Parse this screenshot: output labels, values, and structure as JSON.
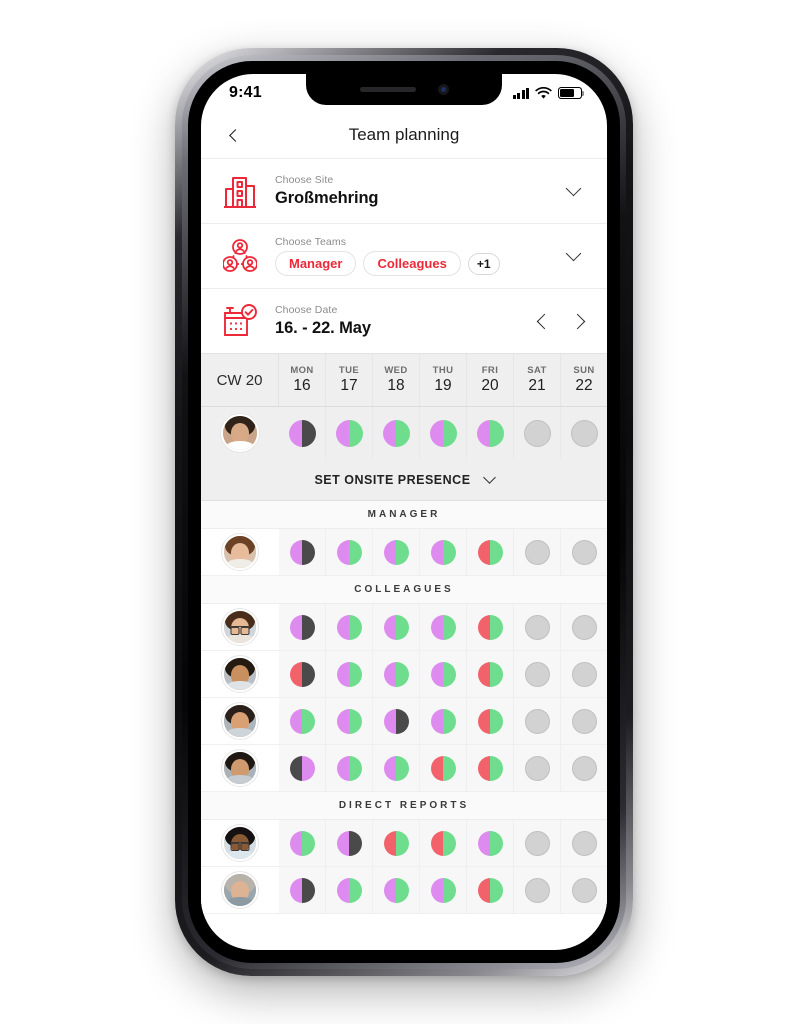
{
  "status_bar": {
    "time": "9:41",
    "signal_icon": "cellular-bars-icon",
    "wifi_icon": "wifi-icon",
    "battery_icon": "battery-icon"
  },
  "nav": {
    "back_icon": "chevron-left-icon",
    "title": "Team planning"
  },
  "selectors": [
    {
      "key": "site",
      "icon": "building-icon",
      "label": "Choose Site",
      "value": "Großmehring",
      "chevron_icon": "chevron-down-icon"
    },
    {
      "key": "teams",
      "icon": "team-network-icon",
      "label": "Choose Teams",
      "chips": [
        "Manager",
        "Colleagues"
      ],
      "more": "+1",
      "chevron_icon": "chevron-down-icon"
    },
    {
      "key": "date",
      "icon": "calendar-check-icon",
      "label": "Choose Date",
      "value": "16. - 22. May",
      "prev_icon": "chevron-left-icon",
      "next_icon": "chevron-right-icon"
    }
  ],
  "week": {
    "cw_label": "CW 20",
    "days": [
      {
        "name": "MON",
        "num": "16"
      },
      {
        "name": "TUE",
        "num": "17"
      },
      {
        "name": "WED",
        "num": "18"
      },
      {
        "name": "THU",
        "num": "19"
      },
      {
        "name": "FRI",
        "num": "20"
      },
      {
        "name": "SAT",
        "num": "21"
      },
      {
        "name": "SUN",
        "num": "22"
      }
    ]
  },
  "onsite_bar": {
    "label": "SET ONSITE PRESENCE",
    "chevron_icon": "chevron-down-icon"
  },
  "colors": {
    "brand_red": "#ED2939",
    "status_purple": "#DD8BEE",
    "status_green": "#6EDD8E",
    "status_red": "#F2626B",
    "status_dark": "#4A4A4A",
    "status_empty": "#D2D2D2"
  },
  "legend_status_keys": [
    "purple",
    "green",
    "red",
    "dark",
    "empty"
  ],
  "me_row": {
    "avatar": {
      "skin": "#d8a987",
      "hair": "#2e2219",
      "shirt": "#ffffff",
      "bg": "#c9a489",
      "glasses": false
    },
    "days": [
      {
        "left": "purple",
        "right": "dark"
      },
      {
        "left": "purple",
        "right": "green"
      },
      {
        "left": "purple",
        "right": "green"
      },
      {
        "left": "purple",
        "right": "green"
      },
      {
        "left": "purple",
        "right": "green"
      },
      {
        "left": "empty",
        "right": "empty"
      },
      {
        "left": "empty",
        "right": "empty"
      }
    ]
  },
  "groups": [
    {
      "title": "MANAGER",
      "rows": [
        {
          "avatar": {
            "skin": "#e8bb9b",
            "hair": "#6b4226",
            "shirt": "#f0ece6",
            "bg": "#d9c2ad",
            "glasses": false
          },
          "days": [
            {
              "left": "purple",
              "right": "dark"
            },
            {
              "left": "purple",
              "right": "green"
            },
            {
              "left": "purple",
              "right": "green"
            },
            {
              "left": "purple",
              "right": "green"
            },
            {
              "left": "red",
              "right": "green"
            },
            {
              "left": "empty",
              "right": "empty"
            },
            {
              "left": "empty",
              "right": "empty"
            }
          ]
        }
      ]
    },
    {
      "title": "COLLEAGUES",
      "rows": [
        {
          "avatar": {
            "skin": "#e7b894",
            "hair": "#4a2c1a",
            "shirt": "#e9e4dc",
            "bg": "#cfd6dc",
            "glasses": true
          },
          "days": [
            {
              "left": "purple",
              "right": "dark"
            },
            {
              "left": "purple",
              "right": "green"
            },
            {
              "left": "purple",
              "right": "green"
            },
            {
              "left": "purple",
              "right": "green"
            },
            {
              "left": "red",
              "right": "green"
            },
            {
              "left": "empty",
              "right": "empty"
            },
            {
              "left": "empty",
              "right": "empty"
            }
          ]
        },
        {
          "avatar": {
            "skin": "#c98f5e",
            "hair": "#241a12",
            "shirt": "#dfe3e6",
            "bg": "#b9bfc4",
            "glasses": false
          },
          "days": [
            {
              "left": "red",
              "right": "dark"
            },
            {
              "left": "purple",
              "right": "green"
            },
            {
              "left": "purple",
              "right": "green"
            },
            {
              "left": "purple",
              "right": "green"
            },
            {
              "left": "red",
              "right": "green"
            },
            {
              "left": "empty",
              "right": "empty"
            },
            {
              "left": "empty",
              "right": "empty"
            }
          ]
        },
        {
          "avatar": {
            "skin": "#d9a173",
            "hair": "#2b2019",
            "shirt": "#cfd4d8",
            "bg": "#aeb6bd",
            "glasses": false
          },
          "days": [
            {
              "left": "purple",
              "right": "green"
            },
            {
              "left": "purple",
              "right": "green"
            },
            {
              "left": "purple",
              "right": "dark"
            },
            {
              "left": "purple",
              "right": "green"
            },
            {
              "left": "red",
              "right": "green"
            },
            {
              "left": "empty",
              "right": "empty"
            },
            {
              "left": "empty",
              "right": "empty"
            }
          ]
        },
        {
          "avatar": {
            "skin": "#cf9a6d",
            "hair": "#1f1711",
            "shirt": "#c6ccd2",
            "bg": "#a9b2b9",
            "glasses": false
          },
          "days": [
            {
              "left": "dark",
              "right": "purple"
            },
            {
              "left": "purple",
              "right": "green"
            },
            {
              "left": "purple",
              "right": "green"
            },
            {
              "left": "red",
              "right": "green"
            },
            {
              "left": "red",
              "right": "green"
            },
            {
              "left": "empty",
              "right": "empty"
            },
            {
              "left": "empty",
              "right": "empty"
            }
          ]
        }
      ]
    },
    {
      "title": "DIRECT REPORTS",
      "rows": [
        {
          "avatar": {
            "skin": "#8a5a34",
            "hair": "#151110",
            "shirt": "#dbe7ec",
            "bg": "#d5dde2",
            "glasses": true
          },
          "days": [
            {
              "left": "purple",
              "right": "green"
            },
            {
              "left": "purple",
              "right": "dark"
            },
            {
              "left": "red",
              "right": "green"
            },
            {
              "left": "red",
              "right": "green"
            },
            {
              "left": "purple",
              "right": "green"
            },
            {
              "left": "empty",
              "right": "empty"
            },
            {
              "left": "empty",
              "right": "empty"
            }
          ]
        },
        {
          "avatar": {
            "skin": "#ddb393",
            "hair": "#b9b2ab",
            "shirt": "#8d9aa2",
            "bg": "#9aa6ad",
            "glasses": false
          },
          "days": [
            {
              "left": "purple",
              "right": "dark"
            },
            {
              "left": "purple",
              "right": "green"
            },
            {
              "left": "purple",
              "right": "green"
            },
            {
              "left": "purple",
              "right": "green"
            },
            {
              "left": "red",
              "right": "green"
            },
            {
              "left": "empty",
              "right": "empty"
            },
            {
              "left": "empty",
              "right": "empty"
            }
          ]
        }
      ]
    }
  ]
}
